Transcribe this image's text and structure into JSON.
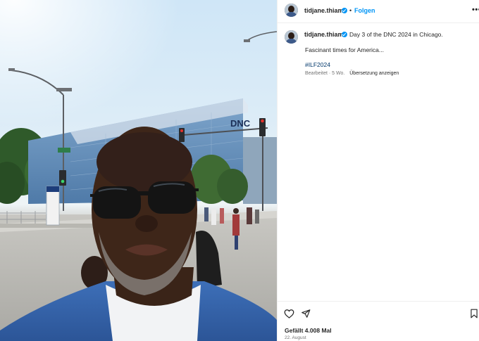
{
  "post": {
    "username": "tidjane.thiam",
    "separator": "•",
    "follow_label": "Folgen",
    "more_label": "•••",
    "caption": "Day 3 of the DNC 2024 in Chicago.",
    "caption_line2": "Fascinant times for America...",
    "hashtag": "#ILF2024",
    "edited_label": "Bearbeitet · 5 Wo.",
    "translate_label": "Übersetzung anzeigen",
    "likes_text": "Gefällt 4.008 Mal",
    "date_text": "22. August"
  },
  "photo": {
    "building_sign": "DNC"
  },
  "icons": {
    "verified": "verified-badge-icon",
    "like": "heart-icon",
    "share": "paper-plane-icon",
    "save": "bookmark-icon",
    "more": "more-options-icon"
  },
  "colors": {
    "accent": "#0095f6",
    "hashtag": "#00376b",
    "secondary_text": "#737373",
    "primary_text": "#262626"
  }
}
